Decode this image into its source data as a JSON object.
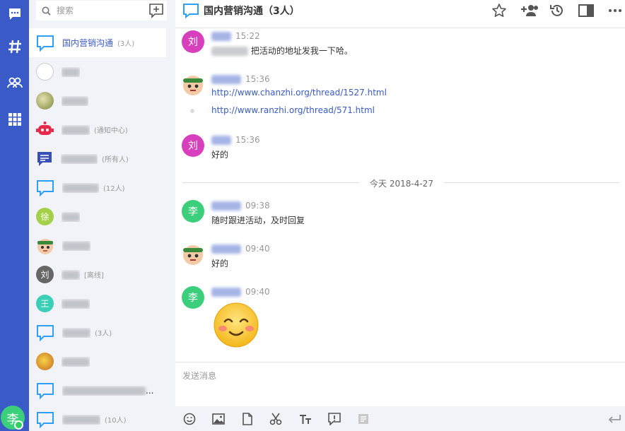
{
  "search": {
    "placeholder": "搜索"
  },
  "contacts": [
    {
      "name": "国内营销沟通",
      "sub": "(3人)",
      "avatar_text": ""
    },
    {
      "name": "",
      "sub": "",
      "avatar_text": ""
    },
    {
      "name": "",
      "sub": "",
      "avatar_text": ""
    },
    {
      "name": "",
      "sub": "(通知中心)",
      "avatar_text": ""
    },
    {
      "name": "",
      "sub": "(所有人)",
      "avatar_text": ""
    },
    {
      "name": "",
      "sub": "(12人)",
      "avatar_text": ""
    },
    {
      "name": "",
      "sub": "",
      "avatar_text": "徐"
    },
    {
      "name": "",
      "sub": "",
      "avatar_text": ""
    },
    {
      "name": "",
      "sub": "[离线]",
      "avatar_text": "刘"
    },
    {
      "name": "",
      "sub": "",
      "avatar_text": "王"
    },
    {
      "name": "",
      "sub": "(3人)",
      "avatar_text": ""
    },
    {
      "name": "",
      "sub": "",
      "avatar_text": ""
    },
    {
      "name": "...",
      "sub": "",
      "avatar_text": ""
    },
    {
      "name": "",
      "sub": "(10人)",
      "avatar_text": ""
    }
  ],
  "header": {
    "title": "国内营销沟通（3人）"
  },
  "messages": [
    {
      "avatar_text": "刘",
      "time": "15:22",
      "text": "把活动的地址发我一下哈。"
    },
    {
      "avatar_text": "",
      "time": "15:36",
      "links": [
        "http://www.chanzhi.org/thread/1527.html",
        "http://www.ranzhi.org/thread/571.html"
      ]
    },
    {
      "avatar_text": "刘",
      "time": "15:36",
      "text": "好的"
    },
    {
      "avatar_text": "李",
      "time": "09:38",
      "text": "随时跟进活动，及时回复"
    },
    {
      "avatar_text": "",
      "time": "09:40",
      "text": "好的"
    },
    {
      "avatar_text": "李",
      "time": "09:40",
      "text": ""
    }
  ],
  "divider": {
    "label": "今天 2018-4-27"
  },
  "compose": {
    "placeholder": "发送消息"
  },
  "user": {
    "avatar_text": "李"
  },
  "colors": {
    "primary": "#3a5bc7",
    "liu": "#d83fbd",
    "li": "#3ccf7b",
    "xu": "#a4d048",
    "liu_offline": "#666666",
    "wang": "#3ccfb7"
  }
}
